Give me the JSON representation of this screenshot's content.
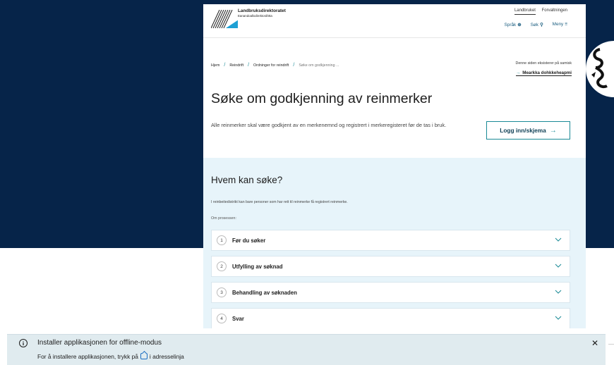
{
  "header": {
    "org_name": "Landbruksdirektoratet",
    "org_sub": "Eanandoallodirektoráhtta",
    "top_links": [
      "Landbruket",
      "Forvaltningen"
    ],
    "tools": {
      "language": "Språk",
      "search": "Søk",
      "menu": "Meny"
    }
  },
  "breadcrumb": {
    "items": [
      "Hjem",
      "Reindrift",
      "Ordninger for reindrift"
    ],
    "current": "Søke om godkjenning ..."
  },
  "sami": {
    "note": "Denne siden eksisterer på samisk",
    "link": "Mearkka dohkkeheapmi"
  },
  "main": {
    "title": "Søke om godkjenning av reinmerker",
    "ingress": "Alle reinmerker skal være godkjent av en merkenemnd og registrert i merkeregisteret før de tas i bruk.",
    "login_button": "Logg inn/skjema"
  },
  "who": {
    "heading": "Hvem kan søke?",
    "text": "I reinbeitedistrikt kan bare personer som har rett til reinmerke få registrert reinmerke.",
    "process_label": "Om prosessen:",
    "steps": [
      {
        "num": "1",
        "label": "Før du søker"
      },
      {
        "num": "2",
        "label": "Utfylling av søknad"
      },
      {
        "num": "3",
        "label": "Behandling av søknaden"
      },
      {
        "num": "4",
        "label": "Svar"
      }
    ]
  },
  "banner": {
    "title": "Installer applikasjonen for offline-modus",
    "text_before": "For å installere applikasjonen, trykk på",
    "text_after": "i adresselinja"
  },
  "colors": {
    "navy": "#062449",
    "teal": "#1a8a96",
    "light_blue": "#e7f4fa",
    "banner": "#e0ebef"
  },
  "icons": [
    "globe-icon",
    "search-icon",
    "menu-icon",
    "arrow-right-icon",
    "chevron-down-icon",
    "info-icon",
    "install-icon",
    "close-icon"
  ]
}
